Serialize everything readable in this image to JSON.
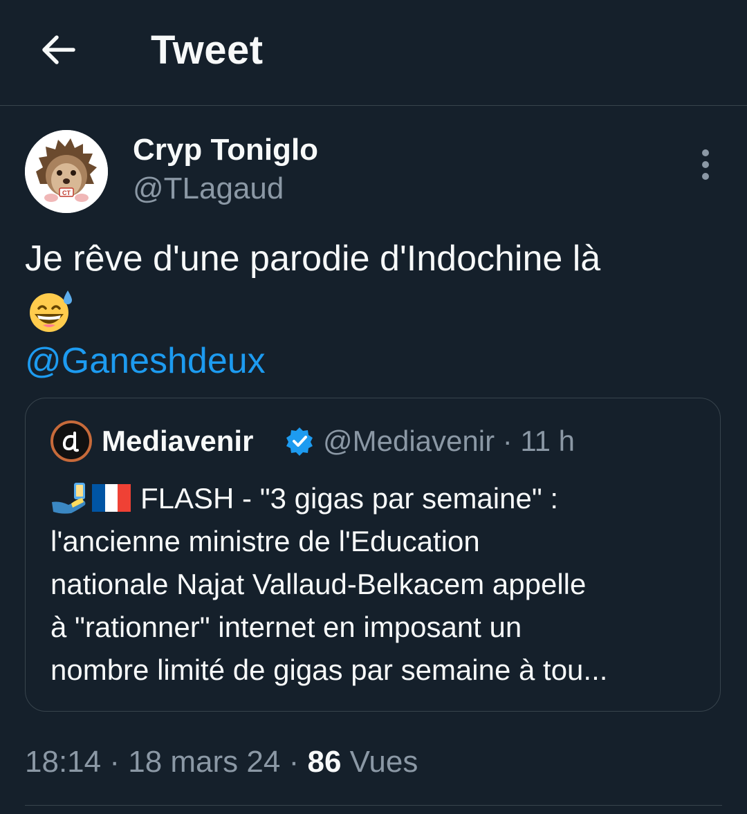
{
  "header": {
    "title": "Tweet",
    "back_icon": "arrow-left-icon"
  },
  "tweet": {
    "author_name": "Cryp Toniglo",
    "author_handle": "@TLagaud",
    "avatar_badge": "CT",
    "text": "Je rêve d'une parodie d'Indochine là",
    "emoji": "grinning-face-with-sweat",
    "mention": "@Ganeshdeux"
  },
  "quoted_tweet": {
    "author_name": "Mediavenir",
    "author_handle": "@Mediavenir",
    "separator": "·",
    "time": "11 h",
    "verified": true,
    "text_lines": [
      "FLASH - \"3 gigas par semaine\" :",
      "l'ancienne ministre de l'Education",
      "nationale Najat Vallaud-Belkacem appelle",
      "à \"rationner\" internet en imposant un",
      "nombre limité de gigas par semaine à tou..."
    ],
    "leading_emojis": [
      "phone-in-hand-emoji",
      "france-flag-emoji"
    ]
  },
  "meta": {
    "time": "18:14",
    "separator": "·",
    "date": "18 mars 24",
    "views_count": "86",
    "views_label": "Vues"
  },
  "colors": {
    "background": "#15202b",
    "link": "#1d9bf0",
    "secondary_text": "#8b98a5",
    "border": "#38444d"
  }
}
